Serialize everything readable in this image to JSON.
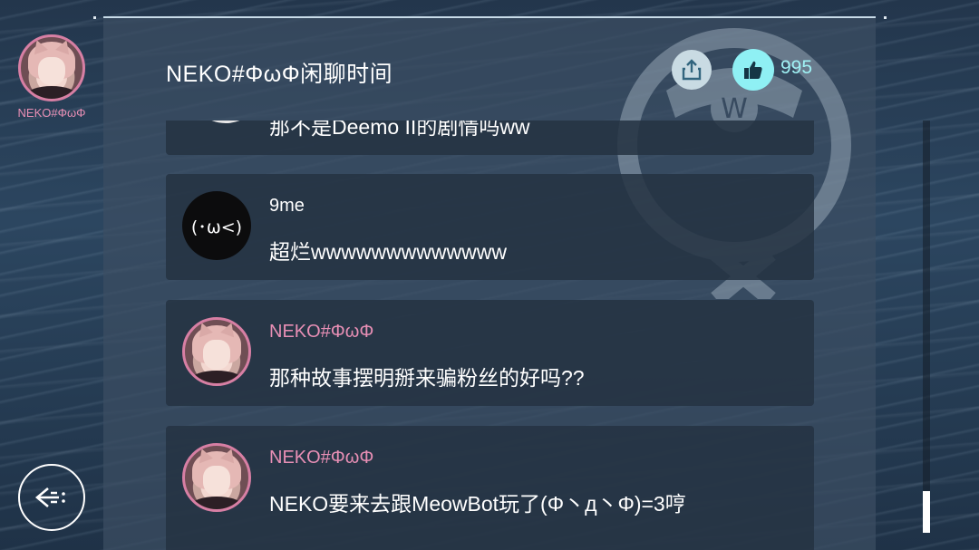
{
  "header": {
    "title": "NEKO#ΦωΦ闲聊时间",
    "like_count": "995"
  },
  "current_user": {
    "name": "NEKO#ΦωΦ"
  },
  "messages": [
    {
      "author": "",
      "text": "那不是Deemo II的剧情吗ww",
      "avatar": "face-avatar"
    },
    {
      "author": "9me",
      "text": "超烂wwwwwwwwwwwww",
      "avatar_glyph": "(･ω<)",
      "author_color": "#ffffff"
    },
    {
      "author": "NEKO#ΦωΦ",
      "text": "那种故事摆明掰来骗粉丝的好吗??",
      "author_color": "#e88fb5"
    },
    {
      "author": "NEKO#ΦωΦ",
      "text": "NEKO要来去跟MeowBot玩了(Φ丶д丶Φ)=3哼",
      "author_color": "#e88fb5"
    }
  ],
  "icons": {
    "share": "share-icon",
    "like": "thumbs-up-icon",
    "back": "back-arrow-icon"
  },
  "colors": {
    "accent_pink": "#e88fb5",
    "like_cyan": "#8ff0f4"
  }
}
